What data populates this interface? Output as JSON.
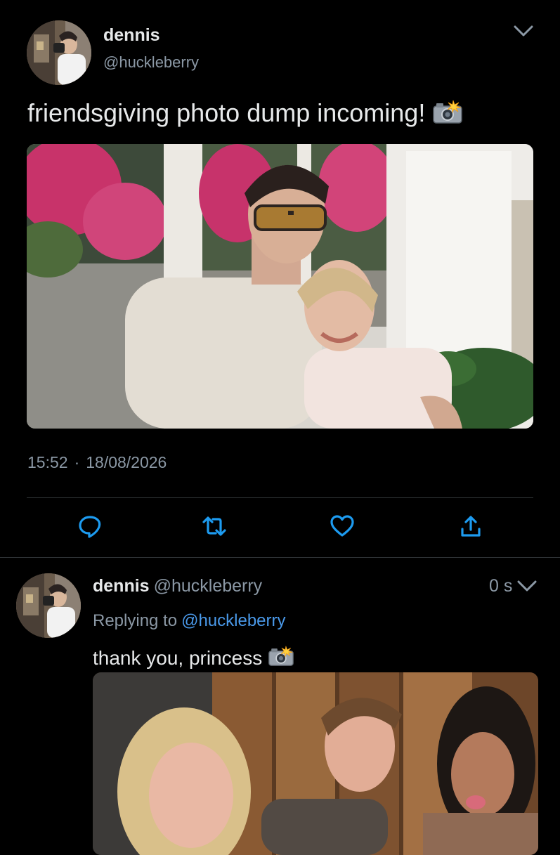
{
  "colors": {
    "background": "#000000",
    "text_primary": "#e7e9ea",
    "text_secondary": "#8b98a5",
    "link": "#4a99e9",
    "divider": "#2f3336"
  },
  "main_tweet": {
    "display_name": "dennis",
    "handle": "@huckleberry",
    "text": "friendsgiving photo dump incoming!",
    "emoji": "camera-with-flash",
    "time": "15:52",
    "separator": "·",
    "date": "18/08/2026",
    "icons": {
      "menu": "chevron-down-icon",
      "reply": "reply-icon",
      "retweet": "retweet-icon",
      "like": "heart-icon",
      "share": "share-icon"
    }
  },
  "reply_tweet": {
    "display_name": "dennis",
    "handle": "@huckleberry",
    "timestamp": "0 s",
    "replying_prefix": "Replying to",
    "replying_mention": "@huckleberry",
    "text": "thank you, princess",
    "emoji": "camera-with-flash"
  }
}
